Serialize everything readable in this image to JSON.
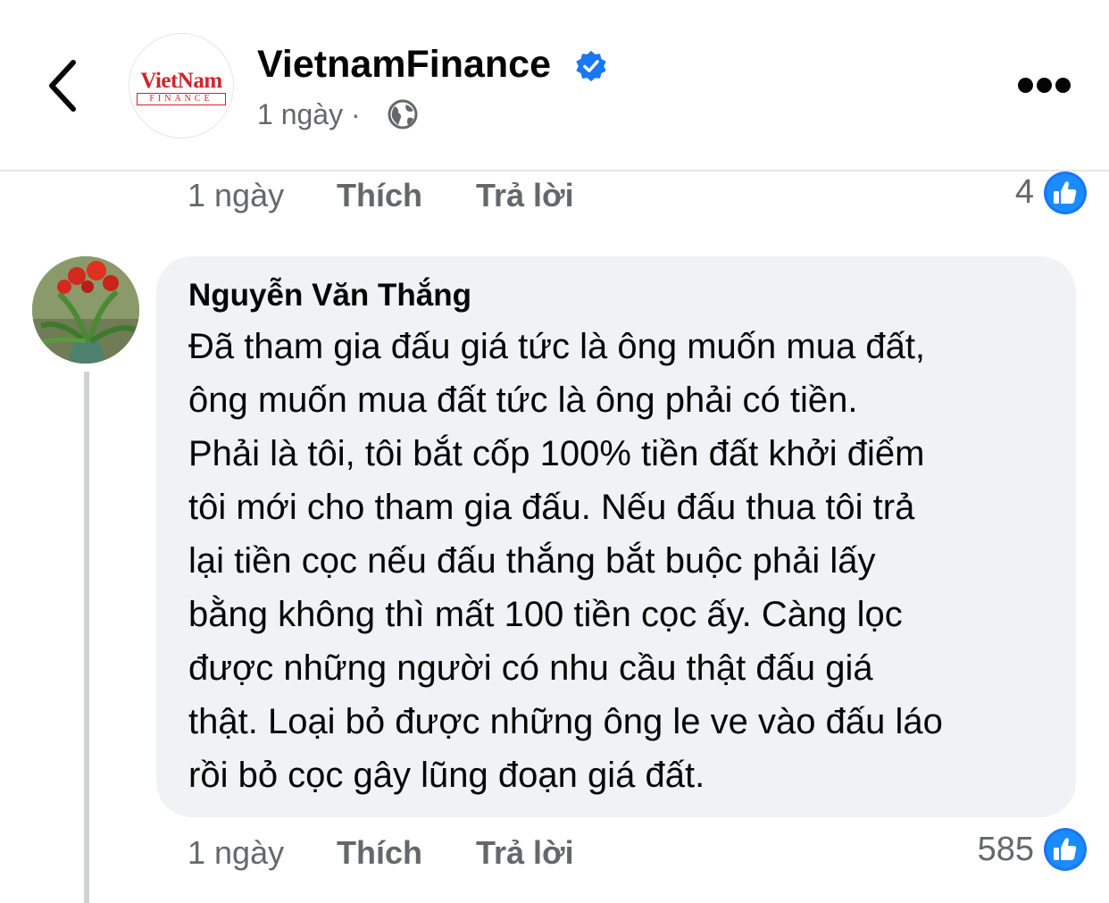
{
  "header": {
    "back_icon": "chevron-left-icon",
    "page_avatar": {
      "logo_top": "VietNam",
      "logo_bottom": "FINANCE"
    },
    "page_name": "VietnamFinance",
    "verified_icon": "verified-badge-icon",
    "time": "1 ngày",
    "separator": "·",
    "privacy_icon": "globe-icon",
    "more_icon": "more-horizontal-icon"
  },
  "previous_comment": {
    "time": "1 ngày",
    "like_label": "Thích",
    "reply_label": "Trả lời",
    "reaction_count": "4",
    "reaction_icon": "like-reaction-icon"
  },
  "comment": {
    "author": "Nguyễn Văn Thắng",
    "lines": [
      "Đã tham gia đấu giá tức là ông muốn mua đất,",
      "ông muốn mua đất tức là ông phải có tiền.",
      "Phải là tôi, tôi bắt cốp 100% tiền đất khởi điểm",
      "tôi mới cho tham gia đấu. Nếu đấu thua tôi trả",
      "lại tiền cọc nếu đấu thắng bắt buộc phải lấy",
      "bằng không thì mất 100 tiền cọc ấy. Càng lọc",
      "được những người có nhu cầu thật đấu giá",
      "thật. Loại bỏ được những ông le ve vào đấu láo",
      "rồi bỏ cọc gây lũng đoạn giá đất."
    ],
    "time": "1 ngày",
    "like_label": "Thích",
    "reply_label": "Trả lời",
    "reaction_count": "585",
    "reaction_icon": "like-reaction-icon"
  },
  "colors": {
    "facebook_blue": "#1877f2",
    "secondary_text": "#65676b",
    "bubble_bg": "#f0f2f5",
    "logo_red": "#d2232a"
  }
}
